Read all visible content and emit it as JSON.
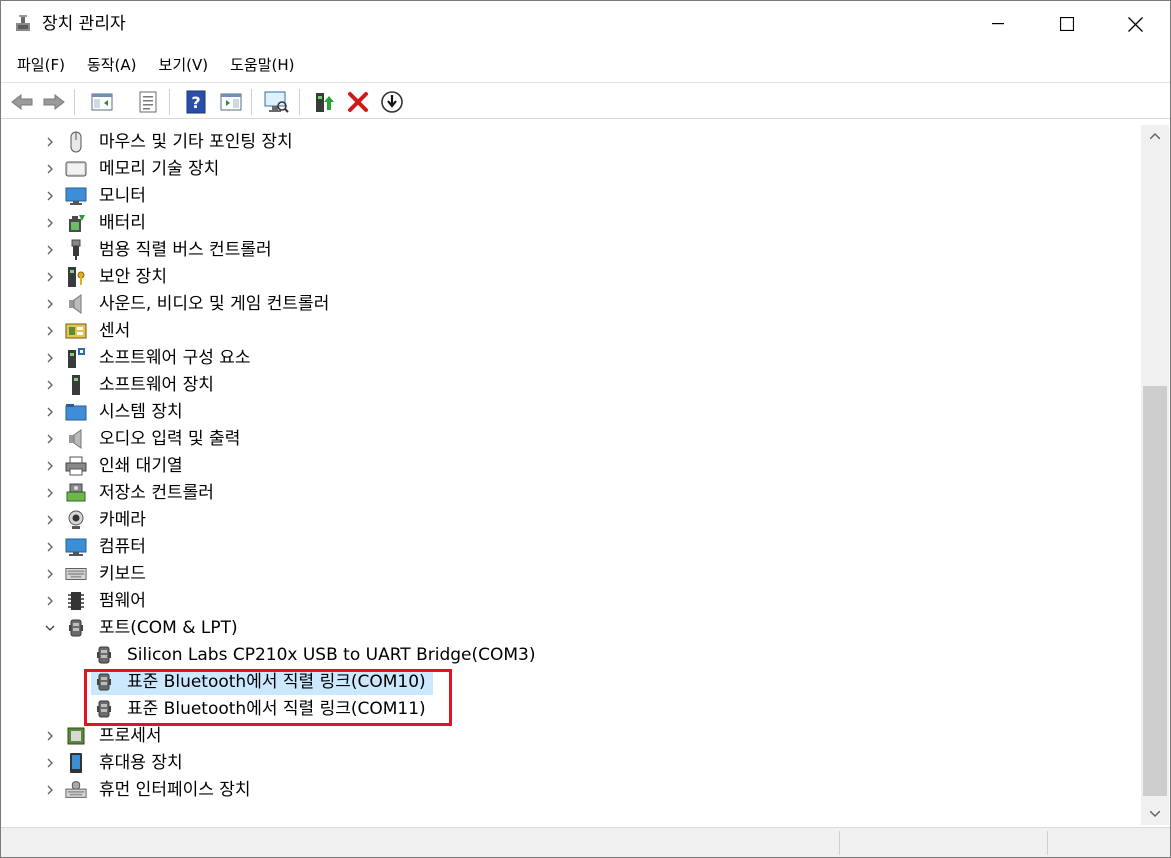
{
  "window": {
    "title": "장치 관리자"
  },
  "menu": [
    {
      "label": "파일(F)"
    },
    {
      "label": "동작(A)"
    },
    {
      "label": "보기(V)"
    },
    {
      "label": "도움말(H)"
    }
  ],
  "toolbar": {
    "buttons": [
      {
        "icon": "back-arrow-icon"
      },
      {
        "icon": "forward-arrow-icon"
      },
      {
        "icon": "show-hide-console-tree-icon"
      },
      {
        "icon": "properties-icon"
      },
      {
        "icon": "help-icon"
      },
      {
        "icon": "action-pane-icon"
      },
      {
        "icon": "scan-hardware-icon"
      },
      {
        "icon": "update-driver-icon"
      },
      {
        "icon": "uninstall-device-icon"
      },
      {
        "icon": "disable-device-icon"
      }
    ]
  },
  "tree": {
    "items": [
      {
        "label": "마우스 및 기타 포인팅 장치",
        "icon": "mouse-icon",
        "expanded": false,
        "level": 0
      },
      {
        "label": "메모리 기술 장치",
        "icon": "memory-device-icon",
        "expanded": false,
        "level": 0
      },
      {
        "label": "모니터",
        "icon": "monitor-icon",
        "expanded": false,
        "level": 0
      },
      {
        "label": "배터리",
        "icon": "battery-icon",
        "expanded": false,
        "level": 0
      },
      {
        "label": "범용 직렬 버스 컨트롤러",
        "icon": "usb-icon",
        "expanded": false,
        "level": 0
      },
      {
        "label": "보안 장치",
        "icon": "security-key-icon",
        "expanded": false,
        "level": 0
      },
      {
        "label": "사운드, 비디오 및 게임 컨트롤러",
        "icon": "speaker-icon",
        "expanded": false,
        "level": 0
      },
      {
        "label": "센서",
        "icon": "sensor-icon",
        "expanded": false,
        "level": 0
      },
      {
        "label": "소프트웨어 구성 요소",
        "icon": "software-component-icon",
        "expanded": false,
        "level": 0
      },
      {
        "label": "소프트웨어 장치",
        "icon": "software-device-icon",
        "expanded": false,
        "level": 0
      },
      {
        "label": "시스템 장치",
        "icon": "system-folder-icon",
        "expanded": false,
        "level": 0
      },
      {
        "label": "오디오 입력 및 출력",
        "icon": "speaker-icon",
        "expanded": false,
        "level": 0
      },
      {
        "label": "인쇄 대기열",
        "icon": "printer-icon",
        "expanded": false,
        "level": 0
      },
      {
        "label": "저장소 컨트롤러",
        "icon": "storage-controller-icon",
        "expanded": false,
        "level": 0
      },
      {
        "label": "카메라",
        "icon": "camera-icon",
        "expanded": false,
        "level": 0
      },
      {
        "label": "컴퓨터",
        "icon": "computer-icon",
        "expanded": false,
        "level": 0
      },
      {
        "label": "키보드",
        "icon": "keyboard-icon",
        "expanded": false,
        "level": 0
      },
      {
        "label": "펌웨어",
        "icon": "firmware-chip-icon",
        "expanded": false,
        "level": 0
      },
      {
        "label": "포트(COM & LPT)",
        "icon": "port-icon",
        "expanded": true,
        "level": 0
      },
      {
        "label": "Silicon Labs CP210x USB to UART Bridge(COM3)",
        "icon": "port-icon",
        "level": 1
      },
      {
        "label": "표준 Bluetooth에서 직렬 링크(COM10)",
        "icon": "port-icon",
        "level": 1,
        "selected": true
      },
      {
        "label": "표준 Bluetooth에서 직렬 링크(COM11)",
        "icon": "port-icon",
        "level": 1
      },
      {
        "label": "프로세서",
        "icon": "processor-icon",
        "expanded": false,
        "level": 0
      },
      {
        "label": "휴대용 장치",
        "icon": "portable-device-icon",
        "expanded": false,
        "level": 0
      },
      {
        "label": "휴먼 인터페이스 장치",
        "icon": "hid-icon",
        "expanded": false,
        "level": 0
      }
    ]
  },
  "colors": {
    "selection": "#cce8ff",
    "highlight_border": "#e0141e"
  }
}
